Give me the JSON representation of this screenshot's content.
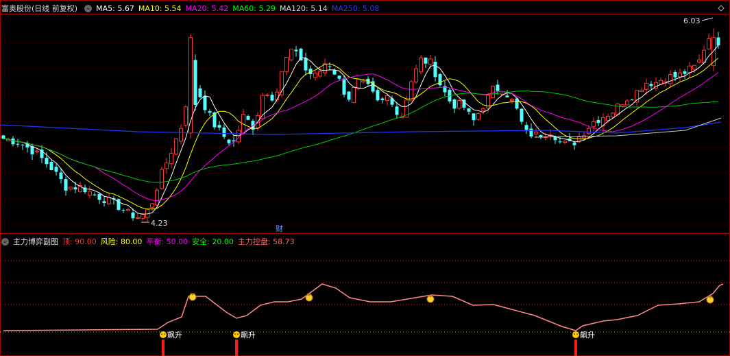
{
  "header": {
    "title": "富奥股份(日线 前复权)",
    "ma": [
      {
        "label": "MA5:",
        "value": "5.67",
        "color": "#ffffff"
      },
      {
        "label": "MA10:",
        "value": "5.54",
        "color": "#ffff00"
      },
      {
        "label": "MA20:",
        "value": "5.42",
        "color": "#ff00ff"
      },
      {
        "label": "MA60:",
        "value": "5.29",
        "color": "#00ff00"
      },
      {
        "label": "MA120:",
        "value": "5.14",
        "color": "#dddddd"
      },
      {
        "label": "MA250:",
        "value": "5.08",
        "color": "#3333ff"
      }
    ]
  },
  "annotations": {
    "high": "6.03",
    "low": "4.23",
    "cai": "财"
  },
  "sub": {
    "title": "主力博弈副图",
    "items": [
      {
        "label": "顶:",
        "value": "90.00",
        "color": "#ff3333"
      },
      {
        "label": "风险:",
        "value": "80.00",
        "color": "#ffff00"
      },
      {
        "label": "平衡:",
        "value": "50.00",
        "color": "#ff00ff"
      },
      {
        "label": "安全:",
        "value": "20.00",
        "color": "#00ff00"
      },
      {
        "label": "主力控盘:",
        "value": "58.73",
        "color": "#ff6666"
      }
    ],
    "signal_label": "飙升"
  },
  "colors": {
    "up": "#ff3333",
    "down": "#54ffff",
    "grid": "#7a0000",
    "border": "#a00000"
  }
}
